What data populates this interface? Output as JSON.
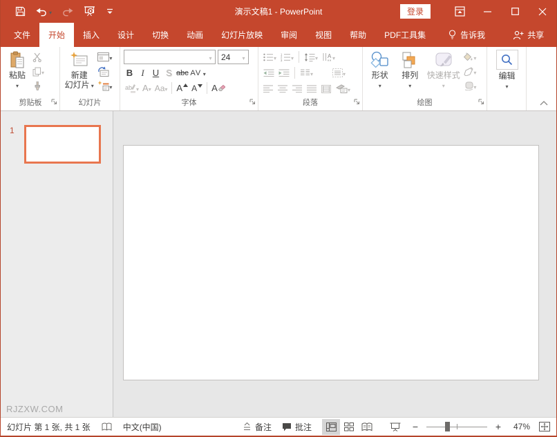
{
  "colors": {
    "accent_red": "#C5472D",
    "thumbnail_border": "#E8764F",
    "arrange_orange": "#F2A854",
    "shapes_blue": "#4E8AC8",
    "editing_blue": "#4472C4"
  },
  "titlebar": {
    "title": "演示文稿1 - PowerPoint",
    "login_label": "登录"
  },
  "tabs": {
    "file": "文件",
    "home": "开始",
    "insert": "插入",
    "design": "设计",
    "transitions": "切换",
    "animations": "动画",
    "slide_show": "幻灯片放映",
    "review": "审阅",
    "view": "视图",
    "help": "帮助",
    "pdf_tools": "PDF工具集",
    "tell_me": "告诉我",
    "share": "共享"
  },
  "ribbon": {
    "clipboard": {
      "group_label": "剪贴板",
      "paste_label": "粘贴"
    },
    "slides": {
      "group_label": "幻灯片",
      "new_slide_line1": "新建",
      "new_slide_line2": "幻灯片"
    },
    "font": {
      "group_label": "字体",
      "font_name_value": "",
      "font_size_value": "24",
      "bold": "B",
      "italic": "I",
      "underline": "U",
      "shadow": "S",
      "strikethrough": "abc",
      "char_spacing": "AV",
      "change_case": "Aa",
      "font_color_letter": "A",
      "grow_font_letter": "A",
      "shrink_font_letter": "A",
      "clear_format_letter": "A"
    },
    "paragraph": {
      "group_label": "段落"
    },
    "drawing": {
      "group_label": "绘图",
      "shapes_label": "形状",
      "arrange_label": "排列",
      "quick_styles_label": "快速样式"
    },
    "editing": {
      "editing_label": "编辑"
    }
  },
  "slide_panel": {
    "slide_number": "1",
    "watermark": "RJZXW.COM"
  },
  "statusbar": {
    "slide_info": "幻灯片 第 1 张, 共 1 张",
    "language": "中文(中国)",
    "notes_label": "备注",
    "comments_label": "批注",
    "zoom_minus": "−",
    "zoom_plus": "+",
    "zoom_percent": "47%"
  }
}
